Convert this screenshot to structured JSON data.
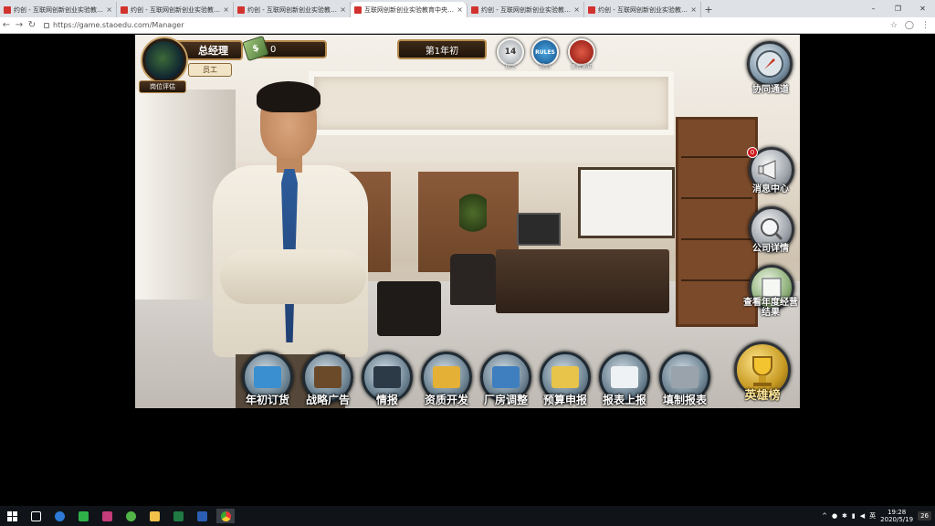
{
  "browser": {
    "tabs": [
      {
        "title": "约创 - 互联网创新创业实验教育...",
        "active": false
      },
      {
        "title": "约创 - 互联网创新创业实验教育...",
        "active": false
      },
      {
        "title": "约创 - 互联网创新创业实验教育...",
        "active": false
      },
      {
        "title": "互联网创新创业实验教育中央平...",
        "active": true
      },
      {
        "title": "约创 - 互联网创新创业实验教育...",
        "active": false
      },
      {
        "title": "约创 - 互联网创新创业实验教育...",
        "active": false
      }
    ],
    "url": "https://game.staoedu.com/Manager",
    "new_tab": "+",
    "close_tab": "×",
    "win_minimize": "–",
    "win_restore": "❐",
    "win_close": "✕",
    "nav_back": "←",
    "nav_forward": "→",
    "nav_reload": "↻",
    "star": "☆",
    "profile": "◯",
    "menu": "⋮"
  },
  "hud": {
    "rank": "总经理",
    "title_badge": "员工",
    "post_button": "岗位评估",
    "money": "0",
    "money_icon": "$",
    "year": "第1年初",
    "calendar_label": "日历",
    "calendar_day": "14",
    "rules_label": "规则",
    "rules_text": "RULES",
    "refresh_label": "更新通知"
  },
  "side": {
    "collab": "协同通道",
    "messages": "消息中心",
    "messages_badge": "0",
    "company": "公司详情",
    "annual": "查看年度经营结果",
    "ranking": "英雄榜"
  },
  "toolbar": [
    {
      "label": "年初订货",
      "icon": "truck-icon",
      "color": "#3a8fd0"
    },
    {
      "label": "战略广告",
      "icon": "tv-icon",
      "color": "#6b4a2a"
    },
    {
      "label": "情报",
      "icon": "binoculars-icon",
      "color": "#2c3a48"
    },
    {
      "label": "资质开发",
      "icon": "certificate-icon",
      "color": "#e4b035"
    },
    {
      "label": "厂房调整",
      "icon": "factory-icon",
      "color": "#3f7fbf"
    },
    {
      "label": "预算申报",
      "icon": "question-book-icon",
      "color": "#e8c44a"
    },
    {
      "label": "报表上报",
      "icon": "chart-board-icon",
      "color": "#eef2f4"
    },
    {
      "label": "填制报表",
      "icon": "bar-chart-icon",
      "color": "#9aa3ab"
    }
  ],
  "taskbar": {
    "clock_time": "19:28",
    "clock_date": "2020/5/19",
    "ime": "英",
    "notif_count": "26"
  },
  "colors": {
    "plate_border": "#b58a4c",
    "plate_bg": "#24170c",
    "alert_red": "#d0191c"
  }
}
